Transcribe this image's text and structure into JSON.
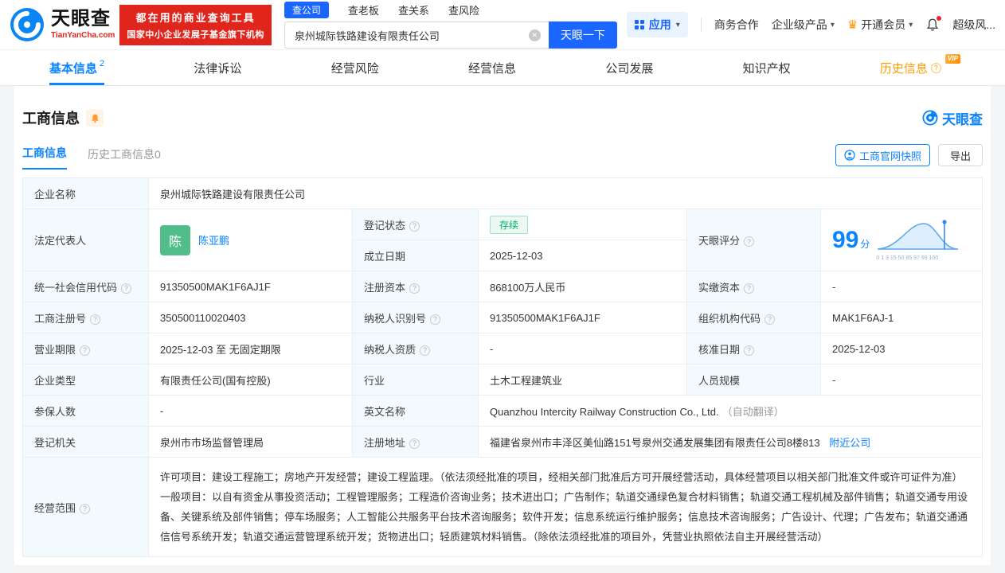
{
  "icons": {
    "help": "?",
    "caret": "▾",
    "crown": "♛",
    "clear": "✕"
  },
  "header": {
    "logo": {
      "brand": "天眼查",
      "domain": "TianYanCha.com"
    },
    "slogan_line1": "都在用的商业查询工具",
    "slogan_line2": "国家中小企业发展子基金旗下机构",
    "search": {
      "tabs": [
        {
          "label": "查公司"
        },
        {
          "label": "查老板"
        },
        {
          "label": "查关系"
        },
        {
          "label": "查风险"
        }
      ],
      "value": "泉州城际铁路建设有限责任公司",
      "button": "天眼一下"
    },
    "nav": {
      "apps": "应用",
      "cooperation": "商务合作",
      "enterprise": "企业级产品",
      "vip": "开通会员",
      "super_risk": "超级风..."
    }
  },
  "tabs": [
    {
      "label": "基本信息",
      "count": "2"
    },
    {
      "label": "法律诉讼"
    },
    {
      "label": "经营风险"
    },
    {
      "label": "经营信息"
    },
    {
      "label": "公司发展"
    },
    {
      "label": "知识产权"
    },
    {
      "label": "历史信息",
      "vip_tag": "VIP"
    }
  ],
  "section": {
    "title": "工商信息",
    "watermark": "天眼查",
    "subtab_active": "工商信息",
    "subtab_history": "历史工商信息0",
    "snapshot_button": "工商官网快照",
    "export_button": "导出"
  },
  "company": {
    "name_label": "企业名称",
    "name": "泉州城际铁路建设有限责任公司",
    "legal_rep_label": "法定代表人",
    "legal_rep_avatar": "陈",
    "legal_rep_name": "陈亚鹏",
    "reg_status_label": "登记状态",
    "reg_status": "存续",
    "establish_label": "成立日期",
    "establish_date": "2025-12-03",
    "score_label": "天眼评分",
    "score": "99",
    "score_unit": "分",
    "score_axis": "0 1 3 15 50 85 97 99 100",
    "credit_code_label": "统一社会信用代码",
    "credit_code": "91350500MAK1F6AJ1F",
    "reg_capital_label": "注册资本",
    "reg_capital": "868100万人民币",
    "paid_capital_label": "实缴资本",
    "paid_capital": "-",
    "reg_no_label": "工商注册号",
    "reg_no": "350500110020403",
    "taxpayer_id_label": "纳税人识别号",
    "taxpayer_id": "91350500MAK1F6AJ1F",
    "org_code_label": "组织机构代码",
    "org_code": "MAK1F6AJ-1",
    "term_label": "营业期限",
    "term": "2025-12-03 至 无固定期限",
    "taxpayer_qual_label": "纳税人资质",
    "taxpayer_qual": "-",
    "approval_label": "核准日期",
    "approval_date": "2025-12-03",
    "type_label": "企业类型",
    "type": "有限责任公司(国有控股)",
    "industry_label": "行业",
    "industry": "土木工程建筑业",
    "staff_label": "人员规模",
    "staff": "-",
    "insured_label": "参保人数",
    "insured": "-",
    "en_name_label": "英文名称",
    "en_name": "Quanzhou Intercity Railway Construction Co., Ltd.",
    "en_name_note": "（自动翻译）",
    "authority_label": "登记机关",
    "authority": "泉州市市场监督管理局",
    "address_label": "注册地址",
    "address": "福建省泉州市丰泽区美仙路151号泉州交通发展集团有限责任公司8楼813",
    "nearby_link": "附近公司",
    "scope_label": "经营范围",
    "scope": "许可项目：建设工程施工；房地产开发经营；建设工程监理。（依法须经批准的项目，经相关部门批准后方可开展经营活动，具体经营项目以相关部门批准文件或许可证件为准）一般项目：以自有资金从事投资活动；工程管理服务；工程造价咨询业务；技术进出口；广告制作；轨道交通绿色复合材料销售；轨道交通工程机械及部件销售；轨道交通专用设备、关键系统及部件销售；停车场服务；人工智能公共服务平台技术咨询服务；软件开发；信息系统运行维护服务；信息技术咨询服务；广告设计、代理；广告发布；轨道交通通信信号系统开发；轨道交通运营管理系统开发；货物进出口；轻质建筑材料销售。（除依法须经批准的项目外，凭营业执照依法自主开展经营活动）"
  }
}
